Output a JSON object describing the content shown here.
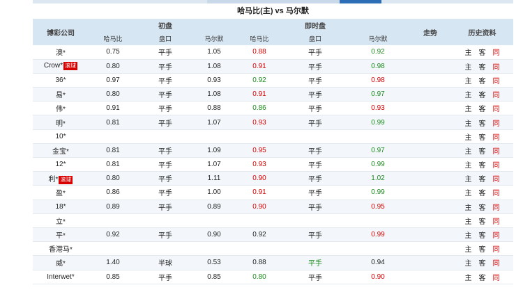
{
  "match_title": "哈马比(主) vs 马尔默",
  "colors": {
    "header_bg": "#d7e6f3",
    "red": "#d40000",
    "green": "#1c8a1c",
    "badge": "#d90000"
  },
  "header": {
    "company": "博彩公司",
    "initial": "初盘",
    "live": "即时盘",
    "trend": "走势",
    "history": "历史资料",
    "home": "哈马比",
    "handicap": "盘口",
    "away": "马尔默"
  },
  "rows": [
    {
      "company": "澳*",
      "badge": "",
      "i_home": "0.75",
      "i_hcp": "平手",
      "i_away": "1.05",
      "l_home": "0.88",
      "l_home_c": "red",
      "l_hcp": "平手",
      "l_hcp_c": "",
      "l_away": "0.92",
      "l_away_c": "green",
      "h": "主",
      "a": "客",
      "t": "同"
    },
    {
      "company": "Crow*",
      "badge": "滚球",
      "i_home": "0.80",
      "i_hcp": "平手",
      "i_away": "1.08",
      "l_home": "0.91",
      "l_home_c": "red",
      "l_hcp": "平手",
      "l_hcp_c": "",
      "l_away": "0.98",
      "l_away_c": "green",
      "h": "主",
      "a": "客",
      "t": "同"
    },
    {
      "company": "36*",
      "badge": "",
      "i_home": "0.97",
      "i_hcp": "平手",
      "i_away": "0.93",
      "l_home": "0.92",
      "l_home_c": "green",
      "l_hcp": "平手",
      "l_hcp_c": "",
      "l_away": "0.98",
      "l_away_c": "red",
      "h": "主",
      "a": "客",
      "t": "同"
    },
    {
      "company": "易*",
      "badge": "",
      "i_home": "0.80",
      "i_hcp": "平手",
      "i_away": "1.08",
      "l_home": "0.91",
      "l_home_c": "red",
      "l_hcp": "平手",
      "l_hcp_c": "",
      "l_away": "0.97",
      "l_away_c": "green",
      "h": "主",
      "a": "客",
      "t": "同"
    },
    {
      "company": "伟*",
      "badge": "",
      "i_home": "0.91",
      "i_hcp": "平手",
      "i_away": "0.88",
      "l_home": "0.86",
      "l_home_c": "green",
      "l_hcp": "平手",
      "l_hcp_c": "",
      "l_away": "0.93",
      "l_away_c": "red",
      "h": "主",
      "a": "客",
      "t": "同"
    },
    {
      "company": "明*",
      "badge": "",
      "i_home": "0.81",
      "i_hcp": "平手",
      "i_away": "1.07",
      "l_home": "0.93",
      "l_home_c": "red",
      "l_hcp": "平手",
      "l_hcp_c": "",
      "l_away": "0.99",
      "l_away_c": "green",
      "h": "主",
      "a": "客",
      "t": "同"
    },
    {
      "company": "10*",
      "badge": "",
      "i_home": "",
      "i_hcp": "",
      "i_away": "",
      "l_home": "",
      "l_home_c": "",
      "l_hcp": "",
      "l_hcp_c": "",
      "l_away": "",
      "l_away_c": "",
      "h": "主",
      "a": "客",
      "t": "同"
    },
    {
      "company": "金宝*",
      "badge": "",
      "i_home": "0.81",
      "i_hcp": "平手",
      "i_away": "1.09",
      "l_home": "0.95",
      "l_home_c": "red",
      "l_hcp": "平手",
      "l_hcp_c": "",
      "l_away": "0.97",
      "l_away_c": "green",
      "h": "主",
      "a": "客",
      "t": "同"
    },
    {
      "company": "12*",
      "badge": "",
      "i_home": "0.81",
      "i_hcp": "平手",
      "i_away": "1.07",
      "l_home": "0.93",
      "l_home_c": "red",
      "l_hcp": "平手",
      "l_hcp_c": "",
      "l_away": "0.99",
      "l_away_c": "green",
      "h": "主",
      "a": "客",
      "t": "同"
    },
    {
      "company": "利*",
      "badge": "滚球",
      "i_home": "0.80",
      "i_hcp": "平手",
      "i_away": "1.11",
      "l_home": "0.90",
      "l_home_c": "red",
      "l_hcp": "平手",
      "l_hcp_c": "",
      "l_away": "1.02",
      "l_away_c": "green",
      "h": "主",
      "a": "客",
      "t": "同"
    },
    {
      "company": "盈*",
      "badge": "",
      "i_home": "0.86",
      "i_hcp": "平手",
      "i_away": "1.00",
      "l_home": "0.91",
      "l_home_c": "red",
      "l_hcp": "平手",
      "l_hcp_c": "",
      "l_away": "0.99",
      "l_away_c": "green",
      "h": "主",
      "a": "客",
      "t": "同"
    },
    {
      "company": "18*",
      "badge": "",
      "i_home": "0.89",
      "i_hcp": "平手",
      "i_away": "0.89",
      "l_home": "0.90",
      "l_home_c": "red",
      "l_hcp": "平手",
      "l_hcp_c": "",
      "l_away": "0.95",
      "l_away_c": "red",
      "h": "主",
      "a": "客",
      "t": "同"
    },
    {
      "company": "立*",
      "badge": "",
      "i_home": "",
      "i_hcp": "",
      "i_away": "",
      "l_home": "",
      "l_home_c": "",
      "l_hcp": "",
      "l_hcp_c": "",
      "l_away": "",
      "l_away_c": "",
      "h": "主",
      "a": "客",
      "t": "同"
    },
    {
      "company": "平*",
      "badge": "",
      "i_home": "0.92",
      "i_hcp": "平手",
      "i_away": "0.90",
      "l_home": "0.92",
      "l_home_c": "",
      "l_hcp": "平手",
      "l_hcp_c": "",
      "l_away": "0.99",
      "l_away_c": "red",
      "h": "主",
      "a": "客",
      "t": "同"
    },
    {
      "company": "香港马*",
      "badge": "",
      "i_home": "",
      "i_hcp": "",
      "i_away": "",
      "l_home": "",
      "l_home_c": "",
      "l_hcp": "",
      "l_hcp_c": "",
      "l_away": "",
      "l_away_c": "",
      "h": "主",
      "a": "客",
      "t": "同"
    },
    {
      "company": "威*",
      "badge": "",
      "i_home": "1.40",
      "i_hcp": "半球",
      "i_away": "0.53",
      "l_home": "0.88",
      "l_home_c": "",
      "l_hcp": "平手",
      "l_hcp_c": "green",
      "l_away": "0.94",
      "l_away_c": "",
      "h": "主",
      "a": "客",
      "t": "同"
    },
    {
      "company": "Interwet*",
      "badge": "",
      "i_home": "0.85",
      "i_hcp": "平手",
      "i_away": "0.85",
      "l_home": "0.80",
      "l_home_c": "green",
      "l_hcp": "平手",
      "l_hcp_c": "",
      "l_away": "0.90",
      "l_away_c": "red",
      "h": "主",
      "a": "客",
      "t": "同"
    }
  ]
}
